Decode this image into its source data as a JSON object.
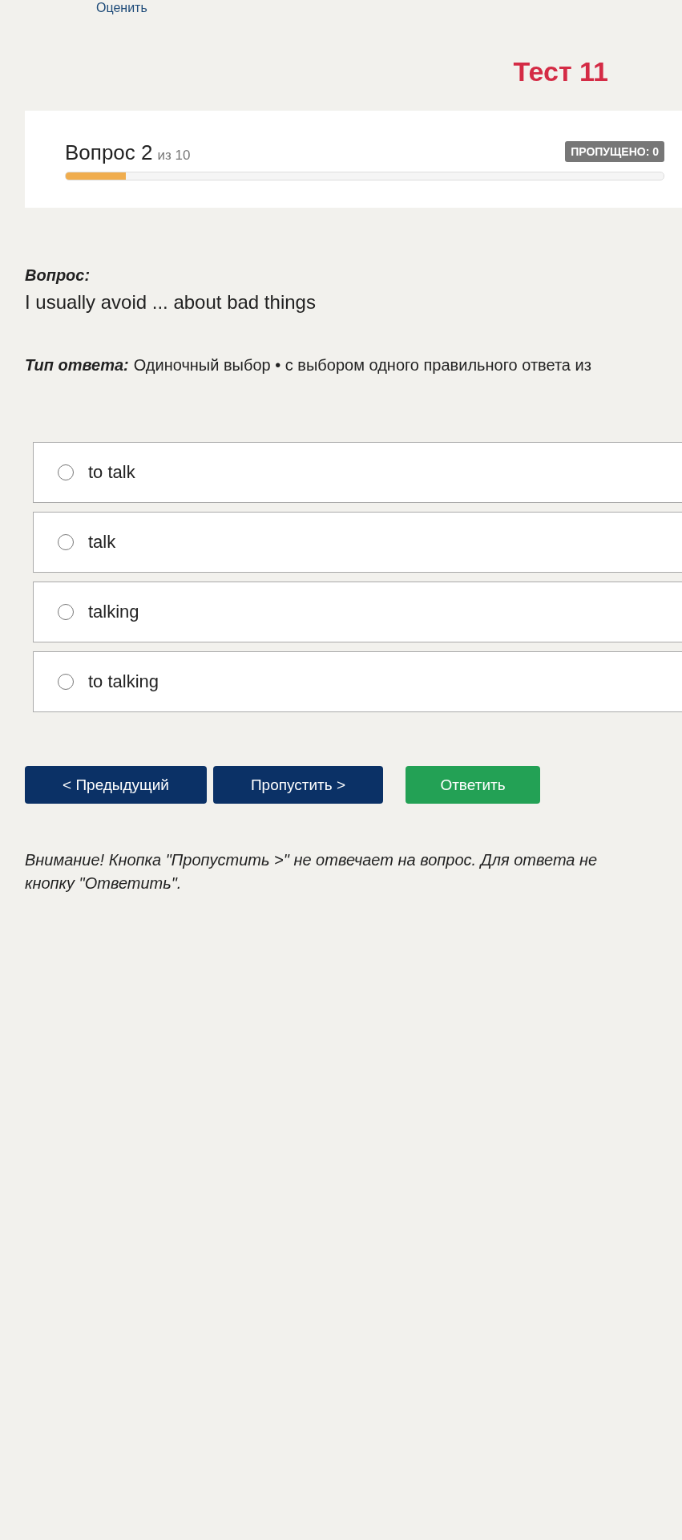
{
  "top_link": "Оценить",
  "test_title": "Тест 11",
  "progress": {
    "question_label": "Вопрос 2",
    "of_label": "из 10",
    "skipped_badge": "ПРОПУЩЕНО: 0",
    "level": 0.1
  },
  "question": {
    "label": "Вопрос:",
    "text": "I usually avoid ... about bad things"
  },
  "answer_type": {
    "label": "Тип ответа:",
    "text": "Одиночный выбор • с выбором одного правильного ответа из"
  },
  "options": [
    {
      "label": "to talk",
      "selected": false
    },
    {
      "label": "talk",
      "selected": false
    },
    {
      "label": "talking",
      "selected": false
    },
    {
      "label": "to talking",
      "selected": false
    }
  ],
  "buttons": [
    {
      "label": "< Предыдущий",
      "kind": "nav"
    },
    {
      "label": "Пропустить >",
      "kind": "nav"
    },
    {
      "label": "Ответить",
      "kind": "submit"
    }
  ],
  "warning_lines": [
    "Внимание! Кнопка \"Пропустить >\" не отвечает на вопрос. Для ответа не",
    "кнопку \"Ответить\"."
  ]
}
